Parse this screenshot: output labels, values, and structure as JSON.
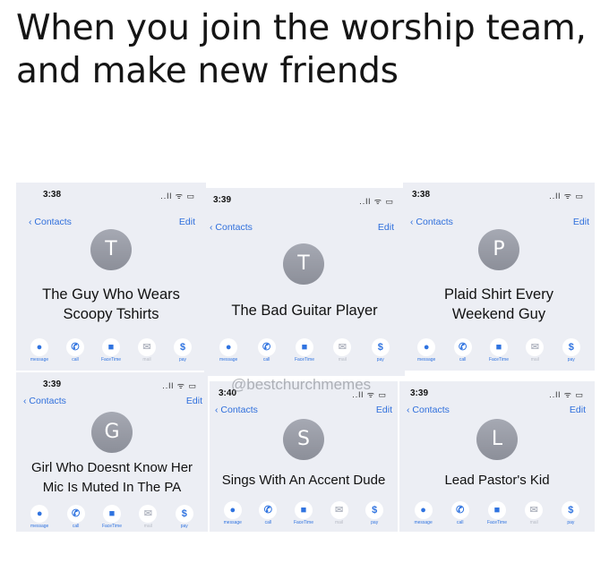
{
  "caption": "When you join the worship team, and make new friends",
  "watermark": "@bestchurchmemes",
  "action_labels": [
    "message",
    "call",
    "FaceTime",
    "mail",
    "pay"
  ],
  "status_icons": "..ll ᯤ ▭",
  "cards": [
    {
      "time": "3:38",
      "back": "Contacts",
      "edit": "Edit",
      "initial": "T",
      "name_line1": "The Guy Who Wears",
      "name_line2": "Scoopy Tshirts"
    },
    {
      "time": "3:39",
      "back": "Contacts",
      "edit": "Edit",
      "initial": "T",
      "name_line1": "The Bad Guitar Player",
      "name_line2": ""
    },
    {
      "time": "3:38",
      "back": "Contacts",
      "edit": "Edit",
      "initial": "P",
      "name_line1": "Plaid Shirt Every",
      "name_line2": "Weekend Guy"
    },
    {
      "time": "3:39",
      "back": "Contacts",
      "edit": "Edit",
      "initial": "G",
      "name_line1": "Girl Who Doesnt Know Her",
      "name_line2": "Mic Is Muted In The PA"
    },
    {
      "time": "3:40",
      "back": "Contacts",
      "edit": "Edit",
      "initial": "S",
      "name_line1": "Sings With An Accent Dude",
      "name_line2": ""
    },
    {
      "time": "3:39",
      "back": "Contacts",
      "edit": "Edit",
      "initial": "L",
      "name_line1": "Lead Pastor's Kid",
      "name_line2": ""
    }
  ]
}
